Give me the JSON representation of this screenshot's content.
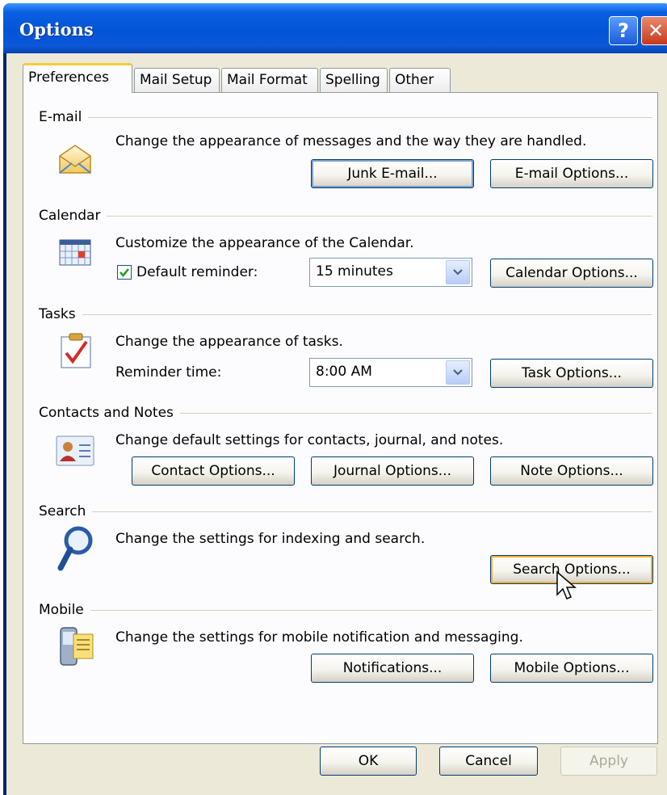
{
  "window": {
    "title": "Options",
    "help_glyph": "?",
    "close_glyph": "✕"
  },
  "tabs": [
    {
      "label": "Preferences",
      "active": true
    },
    {
      "label": "Mail Setup",
      "active": false
    },
    {
      "label": "Mail Format",
      "active": false
    },
    {
      "label": "Spelling",
      "active": false
    },
    {
      "label": "Other",
      "active": false
    }
  ],
  "email": {
    "title": "E-mail",
    "icon": "envelope-icon",
    "description": "Change the appearance of messages and the way they are handled.",
    "junk_button": "Junk E-mail...",
    "options_button": "E-mail Options..."
  },
  "calendar": {
    "title": "Calendar",
    "icon": "calendar-icon",
    "description": "Customize the appearance of the Calendar.",
    "reminder_checked": true,
    "reminder_label": "Default reminder:",
    "reminder_value": "15 minutes",
    "options_button": "Calendar Options..."
  },
  "tasks": {
    "title": "Tasks",
    "icon": "task-checkmark-icon",
    "description": "Change the appearance of tasks.",
    "reminder_label": "Reminder time:",
    "reminder_value": "8:00 AM",
    "options_button": "Task Options..."
  },
  "contacts": {
    "title": "Contacts and Notes",
    "icon": "contact-card-icon",
    "description": "Change default settings for contacts, journal, and notes.",
    "contact_button": "Contact Options...",
    "journal_button": "Journal Options...",
    "note_button": "Note Options..."
  },
  "search": {
    "title": "Search",
    "icon": "magnifier-icon",
    "description": "Change the settings for indexing and search.",
    "options_button": "Search Options..."
  },
  "mobile": {
    "title": "Mobile",
    "icon": "mobile-device-icon",
    "description": "Change the settings for mobile notification and messaging.",
    "notifications_button": "Notifications...",
    "options_button": "Mobile Options..."
  },
  "footer": {
    "ok": "OK",
    "cancel": "Cancel",
    "apply": "Apply"
  },
  "colors": {
    "titlebar": "#0454d6",
    "dialog_bg": "#ece9d8",
    "button_border": "#003c74",
    "active_tab_accent": "#ffc83c"
  }
}
